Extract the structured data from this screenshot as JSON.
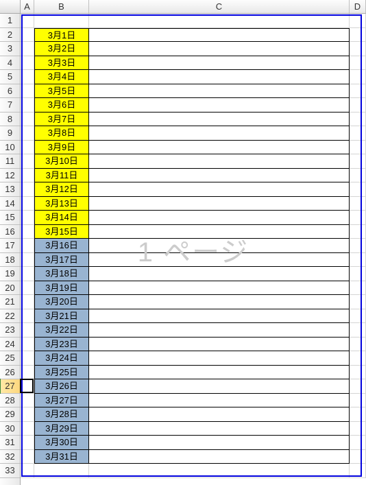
{
  "columns": {
    "A": "A",
    "B": "B",
    "C": "C",
    "D": "D"
  },
  "watermark": "1 ページ",
  "activeRow": 27,
  "rows": [
    {
      "num": 1,
      "b": "",
      "c": "",
      "bg": ""
    },
    {
      "num": 2,
      "b": "3月1日",
      "c": "",
      "bg": "yellow"
    },
    {
      "num": 3,
      "b": "3月2日",
      "c": "",
      "bg": "yellow"
    },
    {
      "num": 4,
      "b": "3月3日",
      "c": "",
      "bg": "yellow"
    },
    {
      "num": 5,
      "b": "3月4日",
      "c": "",
      "bg": "yellow"
    },
    {
      "num": 6,
      "b": "3月5日",
      "c": "",
      "bg": "yellow"
    },
    {
      "num": 7,
      "b": "3月6日",
      "c": "",
      "bg": "yellow"
    },
    {
      "num": 8,
      "b": "3月7日",
      "c": "",
      "bg": "yellow"
    },
    {
      "num": 9,
      "b": "3月8日",
      "c": "",
      "bg": "yellow"
    },
    {
      "num": 10,
      "b": "3月9日",
      "c": "",
      "bg": "yellow"
    },
    {
      "num": 11,
      "b": "3月10日",
      "c": "",
      "bg": "yellow"
    },
    {
      "num": 12,
      "b": "3月11日",
      "c": "",
      "bg": "yellow"
    },
    {
      "num": 13,
      "b": "3月12日",
      "c": "",
      "bg": "yellow"
    },
    {
      "num": 14,
      "b": "3月13日",
      "c": "",
      "bg": "yellow"
    },
    {
      "num": 15,
      "b": "3月14日",
      "c": "",
      "bg": "yellow"
    },
    {
      "num": 16,
      "b": "3月15日",
      "c": "",
      "bg": "yellow"
    },
    {
      "num": 17,
      "b": "3月16日",
      "c": "",
      "bg": "blue"
    },
    {
      "num": 18,
      "b": "3月17日",
      "c": "",
      "bg": "blue"
    },
    {
      "num": 19,
      "b": "3月18日",
      "c": "",
      "bg": "blue"
    },
    {
      "num": 20,
      "b": "3月19日",
      "c": "",
      "bg": "blue"
    },
    {
      "num": 21,
      "b": "3月20日",
      "c": "",
      "bg": "blue"
    },
    {
      "num": 22,
      "b": "3月21日",
      "c": "",
      "bg": "blue"
    },
    {
      "num": 23,
      "b": "3月22日",
      "c": "",
      "bg": "blue"
    },
    {
      "num": 24,
      "b": "3月23日",
      "c": "",
      "bg": "blue"
    },
    {
      "num": 25,
      "b": "3月24日",
      "c": "",
      "bg": "blue"
    },
    {
      "num": 26,
      "b": "3月25日",
      "c": "",
      "bg": "blue"
    },
    {
      "num": 27,
      "b": "3月26日",
      "c": "",
      "bg": "blue"
    },
    {
      "num": 28,
      "b": "3月27日",
      "c": "",
      "bg": "blue"
    },
    {
      "num": 29,
      "b": "3月28日",
      "c": "",
      "bg": "blue"
    },
    {
      "num": 30,
      "b": "3月29日",
      "c": "",
      "bg": "blue"
    },
    {
      "num": 31,
      "b": "3月30日",
      "c": "",
      "bg": "blue"
    },
    {
      "num": 32,
      "b": "3月31日",
      "c": "",
      "bg": "blue"
    },
    {
      "num": 33,
      "b": "",
      "c": "",
      "bg": ""
    }
  ]
}
